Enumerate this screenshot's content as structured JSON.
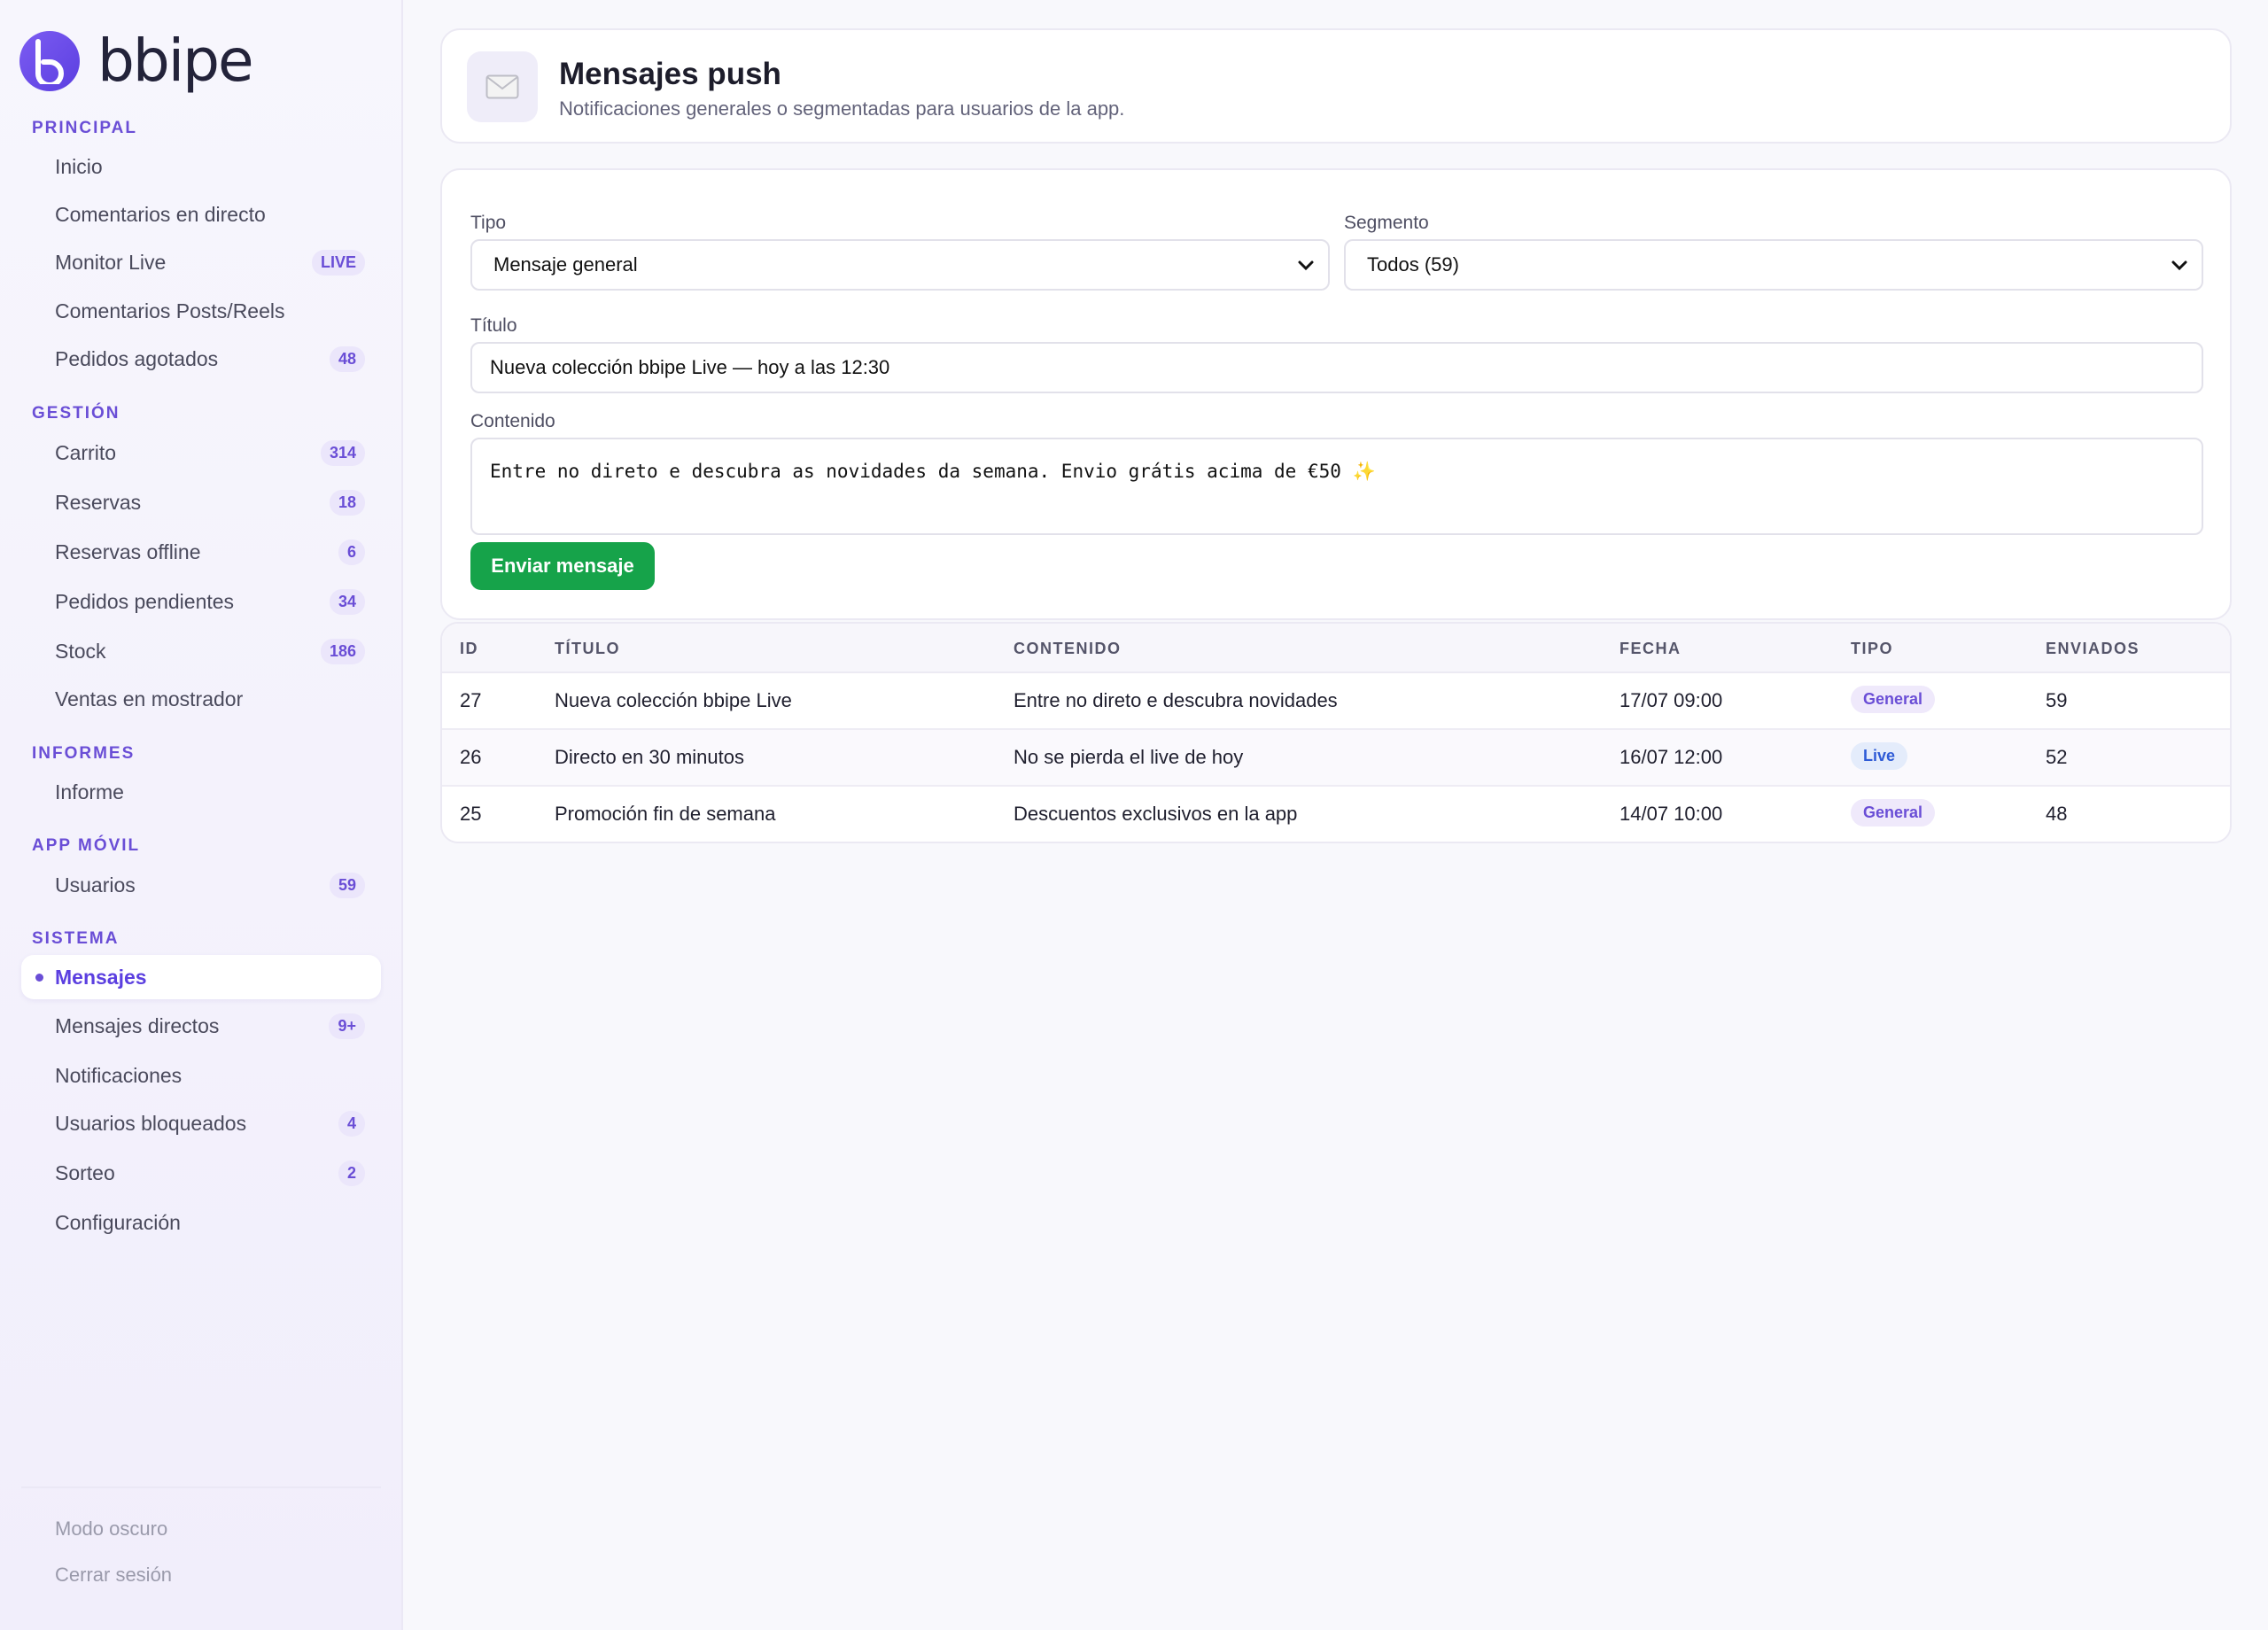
{
  "brand": {
    "name": "bbipe"
  },
  "sidebar": {
    "sections": {
      "principal": "PRINCIPAL",
      "gestion": "GESTIÓN",
      "informes": "INFORMES",
      "app_movil": "APP MÓVIL",
      "sistema": "SISTEMA"
    },
    "items": [
      {
        "label": "Inicio",
        "badge": ""
      },
      {
        "label": "Comentarios en directo",
        "badge": ""
      },
      {
        "label": "Monitor Live",
        "badge": "LIVE"
      },
      {
        "label": "Comentarios Posts/Reels",
        "badge": ""
      },
      {
        "label": "Pedidos agotados",
        "badge": "48"
      },
      {
        "label": "Carrito",
        "badge": "314"
      },
      {
        "label": "Reservas",
        "badge": "18"
      },
      {
        "label": "Reservas offline",
        "badge": "6"
      },
      {
        "label": "Pedidos pendientes",
        "badge": "34"
      },
      {
        "label": "Stock",
        "badge": "186"
      },
      {
        "label": "Ventas en mostrador",
        "badge": ""
      },
      {
        "label": "Informe",
        "badge": ""
      },
      {
        "label": "Usuarios",
        "badge": "59"
      },
      {
        "label": "Mensajes",
        "badge": ""
      },
      {
        "label": "Mensajes directos",
        "badge": "9+"
      },
      {
        "label": "Notificaciones",
        "badge": ""
      },
      {
        "label": "Usuarios bloqueados",
        "badge": "4"
      },
      {
        "label": "Sorteo",
        "badge": "2"
      },
      {
        "label": "Configuración",
        "badge": ""
      }
    ],
    "footer": {
      "dark_mode": "Modo oscuro",
      "logout": "Cerrar sesión"
    }
  },
  "header": {
    "icon": "envelope-icon",
    "title": "Mensajes push",
    "subtitle": "Notificaciones generales o segmentadas para usuarios de la app."
  },
  "form": {
    "tipo_label": "Tipo",
    "tipo_value": "Mensaje general",
    "segmento_label": "Segmento",
    "segmento_value": "Todos (59)",
    "titulo_label": "Título",
    "titulo_value": "Nueva colección bbipe Live — hoy a las 12:30",
    "contenido_label": "Contenido",
    "contenido_value": "Entre no direto e descubra as novidades da semana. Envio grátis acima de €50 ✨",
    "send_label": "Enviar mensaje",
    "send_color": "#16a34a"
  },
  "table": {
    "headers": [
      "ID",
      "TÍTULO",
      "CONTENIDO",
      "FECHA",
      "TIPO",
      "ENVIADOS"
    ],
    "rows": [
      {
        "id": "27",
        "titulo": "Nueva colección bbipe Live",
        "contenido": "Entre no direto e descubra novidades",
        "fecha": "17/07 09:00",
        "tipo": "General",
        "enviados": "59"
      },
      {
        "id": "26",
        "titulo": "Directo en 30 minutos",
        "contenido": "No se pierda el live de hoy",
        "fecha": "16/07 12:00",
        "tipo": "Live",
        "enviados": "52"
      },
      {
        "id": "25",
        "titulo": "Promoción fin de semana",
        "contenido": "Descuentos exclusivos en la app",
        "fecha": "14/07 10:00",
        "tipo": "General",
        "enviados": "48"
      }
    ]
  },
  "colors": {
    "accent": "#6a4ed6",
    "success": "#16a34a"
  }
}
